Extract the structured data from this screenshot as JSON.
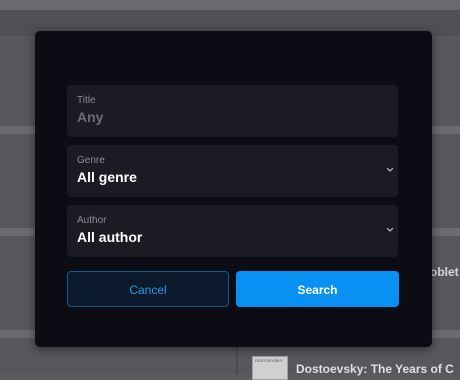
{
  "background": {
    "row_text": "oblet",
    "thumb_label": "DOSTOEVSKY",
    "bottom_text": "Dostoevsky: The Years of C"
  },
  "search_dialog": {
    "title_field": {
      "label": "Title",
      "placeholder": "Any"
    },
    "genre_field": {
      "label": "Genre",
      "value": "All genre"
    },
    "author_field": {
      "label": "Author",
      "value": "All author"
    },
    "cancel_label": "Cancel",
    "search_label": "Search"
  },
  "colors": {
    "accent": "#0890f2",
    "modal_bg": "#0c0c14",
    "field_bg": "#1b1b23"
  }
}
